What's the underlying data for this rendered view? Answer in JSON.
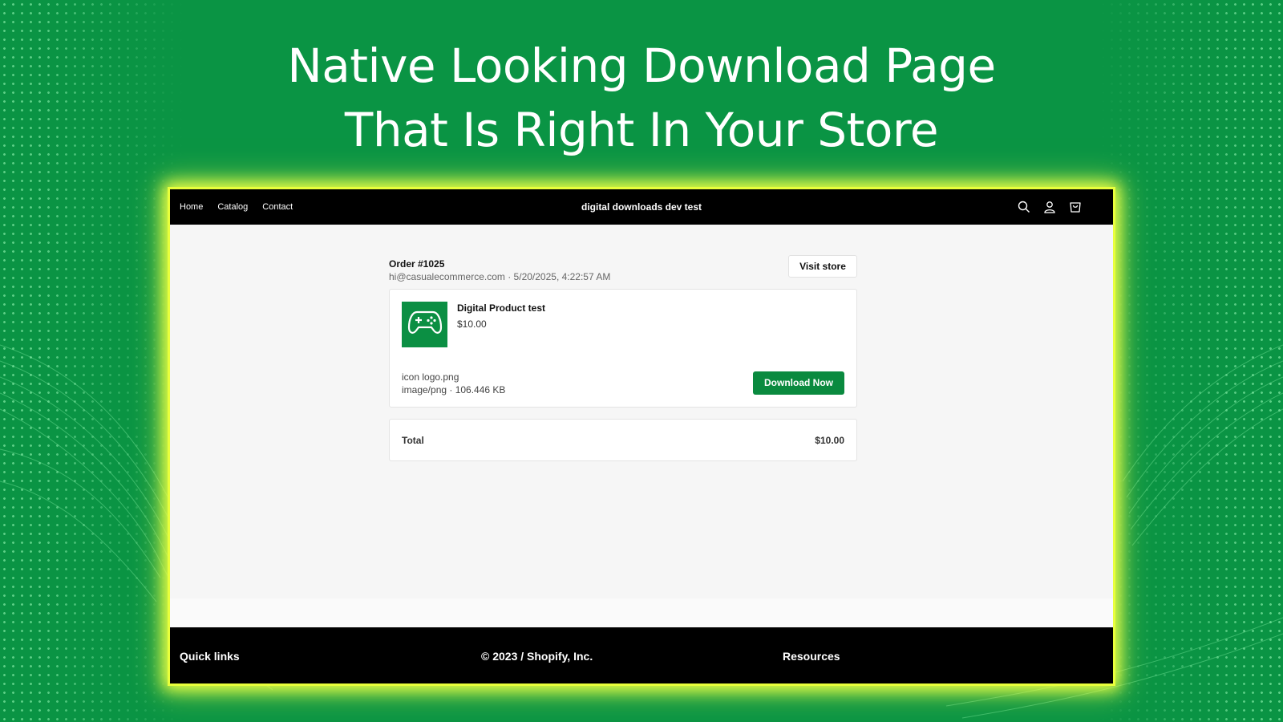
{
  "headline": {
    "line1": "Native Looking Download Page",
    "line2": "That Is Right In Your Store"
  },
  "topbar": {
    "nav": [
      "Home",
      "Catalog",
      "Contact"
    ],
    "store_title": "digital downloads dev test",
    "icons": [
      "search-icon",
      "account-icon",
      "cart-icon"
    ]
  },
  "order": {
    "title": "Order #1025",
    "meta": "hi@casualecommerce.com · 5/20/2025, 4:22:57 AM",
    "visit_store_label": "Visit store"
  },
  "product": {
    "name": "Digital Product test",
    "price": "$10.00",
    "thumbnail_icon": "gamepad-icon",
    "file_name": "icon logo.png",
    "file_meta": "image/png · 106.446 KB",
    "download_label": "Download Now"
  },
  "summary": {
    "total_label": "Total",
    "total_value": "$10.00"
  },
  "footer": {
    "quick_links": "Quick links",
    "copyright": "© 2023 / Shopify, Inc.",
    "resources": "Resources"
  },
  "colors": {
    "background": "#0a9444",
    "glow": "#e8ff3c",
    "button": "#0a8a3f",
    "bar": "#000000"
  }
}
